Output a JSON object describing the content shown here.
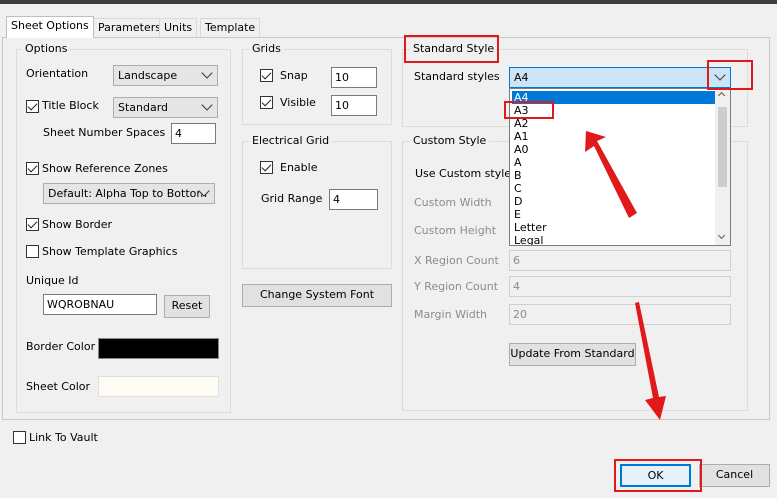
{
  "tabs": [
    "Sheet Options",
    "Parameters",
    "Units",
    "Template"
  ],
  "options": {
    "legend": "Options",
    "orientation_label": "Orientation",
    "orientation_value": "Landscape",
    "title_block_label": "Title Block",
    "title_block_value": "Standard",
    "sheet_number_spaces_label": "Sheet Number Spaces",
    "sheet_number_spaces_value": "4",
    "show_reference_zones_label": "Show Reference Zones",
    "reference_zones_value": "Default: Alpha Top to Bottom",
    "show_border_label": "Show Border",
    "show_template_graphics_label": "Show Template Graphics",
    "unique_id_label": "Unique Id",
    "unique_id_value": "WQROBNAU",
    "reset_label": "Reset",
    "border_color_label": "Border Color",
    "border_color": "#000000",
    "sheet_color_label": "Sheet Color",
    "sheet_color": "#fffbf5"
  },
  "grids": {
    "legend": "Grids",
    "snap_label": "Snap",
    "snap_value": "10",
    "visible_label": "Visible",
    "visible_value": "10"
  },
  "electrical_grid": {
    "legend": "Electrical Grid",
    "enable_label": "Enable",
    "grid_range_label": "Grid Range",
    "grid_range_value": "4"
  },
  "change_font_label": "Change System Font",
  "standard_style": {
    "legend": "Standard Style",
    "label": "Standard styles",
    "value": "A4",
    "options": [
      "A4",
      "A3",
      "A2",
      "A1",
      "A0",
      "A",
      "B",
      "C",
      "D",
      "E",
      "Letter",
      "Legal"
    ]
  },
  "custom_style": {
    "legend": "Custom Style",
    "use_label": "Use Custom style",
    "width_label": "Custom Width",
    "height_label": "Custom Height",
    "x_region_label": "X Region Count",
    "x_region_value": "6",
    "y_region_label": "Y Region Count",
    "y_region_value": "4",
    "margin_label": "Margin Width",
    "margin_value": "20",
    "update_label": "Update From Standard"
  },
  "link_to_vault_label": "Link To Vault",
  "ok_label": "OK",
  "cancel_label": "Cancel",
  "colors": {
    "annotation": "#e0191b",
    "selection": "#0078d7"
  }
}
